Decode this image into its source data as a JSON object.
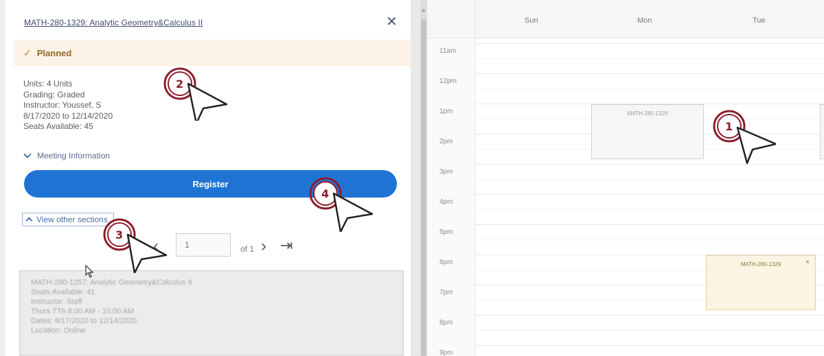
{
  "panel": {
    "course_title": "MATH-280-1329: Analytic Geometry&Calculus II",
    "close_icon": "close-icon",
    "status": {
      "icon": "check-icon",
      "label": "Planned"
    },
    "details": [
      "Units: 4 Units",
      "Grading: Graded",
      "Instructor: Youssef, S",
      "8/17/2020 to 12/14/2020",
      "Seats Available: 45"
    ],
    "meeting_info": "Meeting Information",
    "register_label": "Register",
    "view_other_label": "View other sections",
    "pager": {
      "current": "1",
      "of_label": "of 1"
    },
    "other_section_lines": [
      "MATH-280-1257: Analytic Geometry&Calculus II",
      "Seats Available: 41",
      "Instructor: Staff",
      "Thurs TTh 8:00 AM - 10:00 AM",
      "Dates: 8/17/2020 to 12/14/2020",
      "Location: Online"
    ],
    "colors": {
      "accent": "#1f73d3",
      "status_bg": "#fcf3e6",
      "status_text": "#8f6b2b"
    }
  },
  "calendar": {
    "days": [
      "Sun",
      "Mon",
      "Tue"
    ],
    "times": [
      "11am",
      "12pm",
      "1pm",
      "2pm",
      "3pm",
      "4pm",
      "5pm",
      "6pm",
      "7pm",
      "8pm",
      "9pm"
    ],
    "events": [
      {
        "label": "MATH-280-1329",
        "day": "Mon",
        "start": "1pm",
        "end": "2pm"
      },
      {
        "label": "MATH-280-1329",
        "day": "Tue",
        "start": "6pm",
        "end": "7pm",
        "close": "×"
      }
    ]
  },
  "markers": [
    "1",
    "2",
    "3",
    "4"
  ]
}
